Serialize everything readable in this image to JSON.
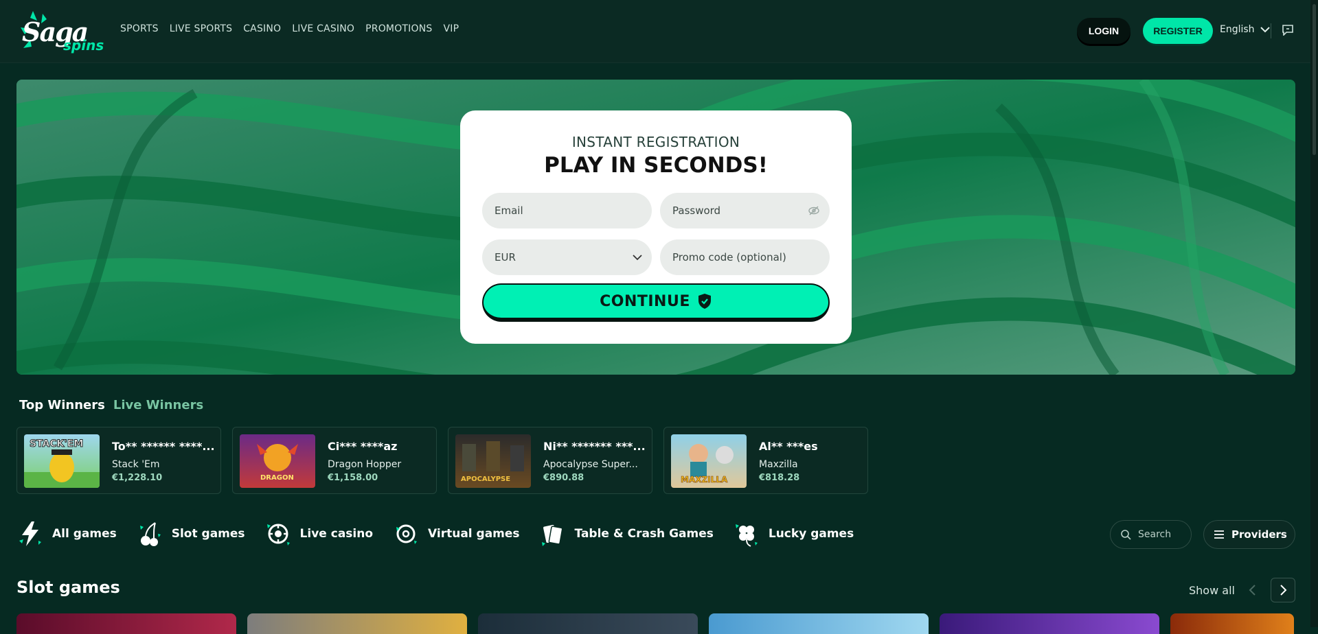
{
  "brand": {
    "logo_main": "Saga",
    "logo_sub": "spins"
  },
  "nav": [
    "SPORTS",
    "LIVE SPORTS",
    "CASINO",
    "LIVE CASINO",
    "PROMOTIONS",
    "VIP"
  ],
  "header": {
    "login": "LOGIN",
    "register": "REGISTER",
    "language": "English"
  },
  "registration": {
    "eyebrow": "INSTANT REGISTRATION",
    "title": "PLAY IN SECONDS!",
    "email_placeholder": "Email",
    "password_placeholder": "Password",
    "currency": "EUR",
    "promo_placeholder": "Promo code (optional)",
    "continue": "CONTINUE"
  },
  "winners_tabs": {
    "active": "Top Winners",
    "inactive": "Live Winners"
  },
  "winners": [
    {
      "user": "To** ****** ****...",
      "game": "Stack 'Em",
      "amount": "€1,228.10",
      "thumb_label": "STACK'EM"
    },
    {
      "user": "Ci*** ****az",
      "game": "Dragon Hopper",
      "amount": "€1,158.00",
      "thumb_label": "DRAGON"
    },
    {
      "user": "Ni** ******* ***...",
      "game": "Apocalypse Super...",
      "amount": "€890.88",
      "thumb_label": "APOCALYPSE"
    },
    {
      "user": "Al** ***es",
      "game": "Maxzilla",
      "amount": "€818.28",
      "thumb_label": "MAXZILLA"
    }
  ],
  "categories": [
    "All games",
    "Slot games",
    "Live casino",
    "Virtual games",
    "Table & Crash Games",
    "Lucky games"
  ],
  "search_label": "Search",
  "providers_label": "Providers",
  "slot_section": {
    "title": "Slot games",
    "show_all": "Show all"
  },
  "colors": {
    "accent": "#00e6a8",
    "background": "#062a22",
    "header": "#0b2a23"
  }
}
